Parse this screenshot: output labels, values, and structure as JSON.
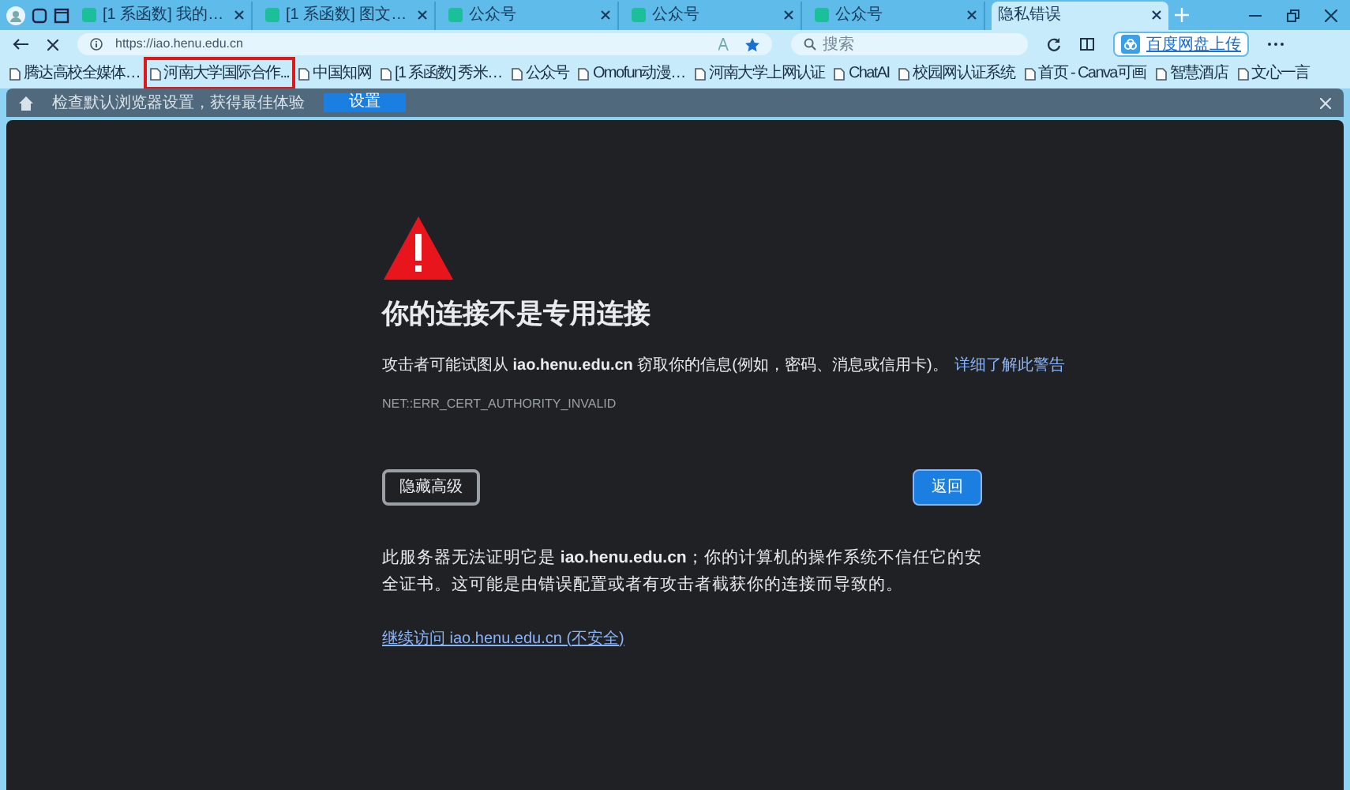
{
  "tabs": [
    {
      "label": "[1 系函数] 我的…",
      "selected": false
    },
    {
      "label": "[1 系函数] 图文…",
      "selected": false
    },
    {
      "label": "公众号",
      "selected": false
    },
    {
      "label": "公众号",
      "selected": false
    },
    {
      "label": "公众号",
      "selected": false
    },
    {
      "label": "隐私错误",
      "selected": true
    }
  ],
  "address_bar": {
    "url": "https://iao.henu.edu.cn"
  },
  "search": {
    "placeholder": "搜索"
  },
  "cloud_button": "百度网盘上传",
  "bookmarks": [
    {
      "label": "腾达高校全媒体…",
      "highlighted": false
    },
    {
      "label": "河南大学国际合作...",
      "highlighted": true
    },
    {
      "label": "中国知网",
      "highlighted": false
    },
    {
      "label": "[1 系函数] 秀米…",
      "highlighted": false
    },
    {
      "label": "公众号",
      "highlighted": false
    },
    {
      "label": "Omofun动漫…",
      "highlighted": false
    },
    {
      "label": "河南大学上网认证",
      "highlighted": false
    },
    {
      "label": "ChatAI",
      "highlighted": false
    },
    {
      "label": "校园网认证系统",
      "highlighted": false
    },
    {
      "label": "首页 - Canva可画",
      "highlighted": false
    },
    {
      "label": "智慧酒店",
      "highlighted": false
    },
    {
      "label": "文心一言",
      "highlighted": false
    }
  ],
  "info_bar": {
    "message": "检查默认浏览器设置，获得最佳体验",
    "button": "设置"
  },
  "error_page": {
    "title": "你的连接不是专用连接",
    "message": "攻击者可能试图从 **iao.henu.edu.cn** 窃取你的信息(例如，密码、消息或信用卡)。",
    "learn_more": "详细了解此警告",
    "error_code": "NET::ERR_CERT_AUTHORITY_INVALID",
    "advanced_button": "隐藏高级",
    "back_button": "返回",
    "details": "此服务器无法证明它是 **iao.henu.edu.cn**；你的计算机的操作系统不信任它的安全证书。这可能是由错误配置或者有攻击者截获你的连接而导致的。",
    "proceed_link": "继续访问 iao.henu.edu.cn (不安全)"
  }
}
